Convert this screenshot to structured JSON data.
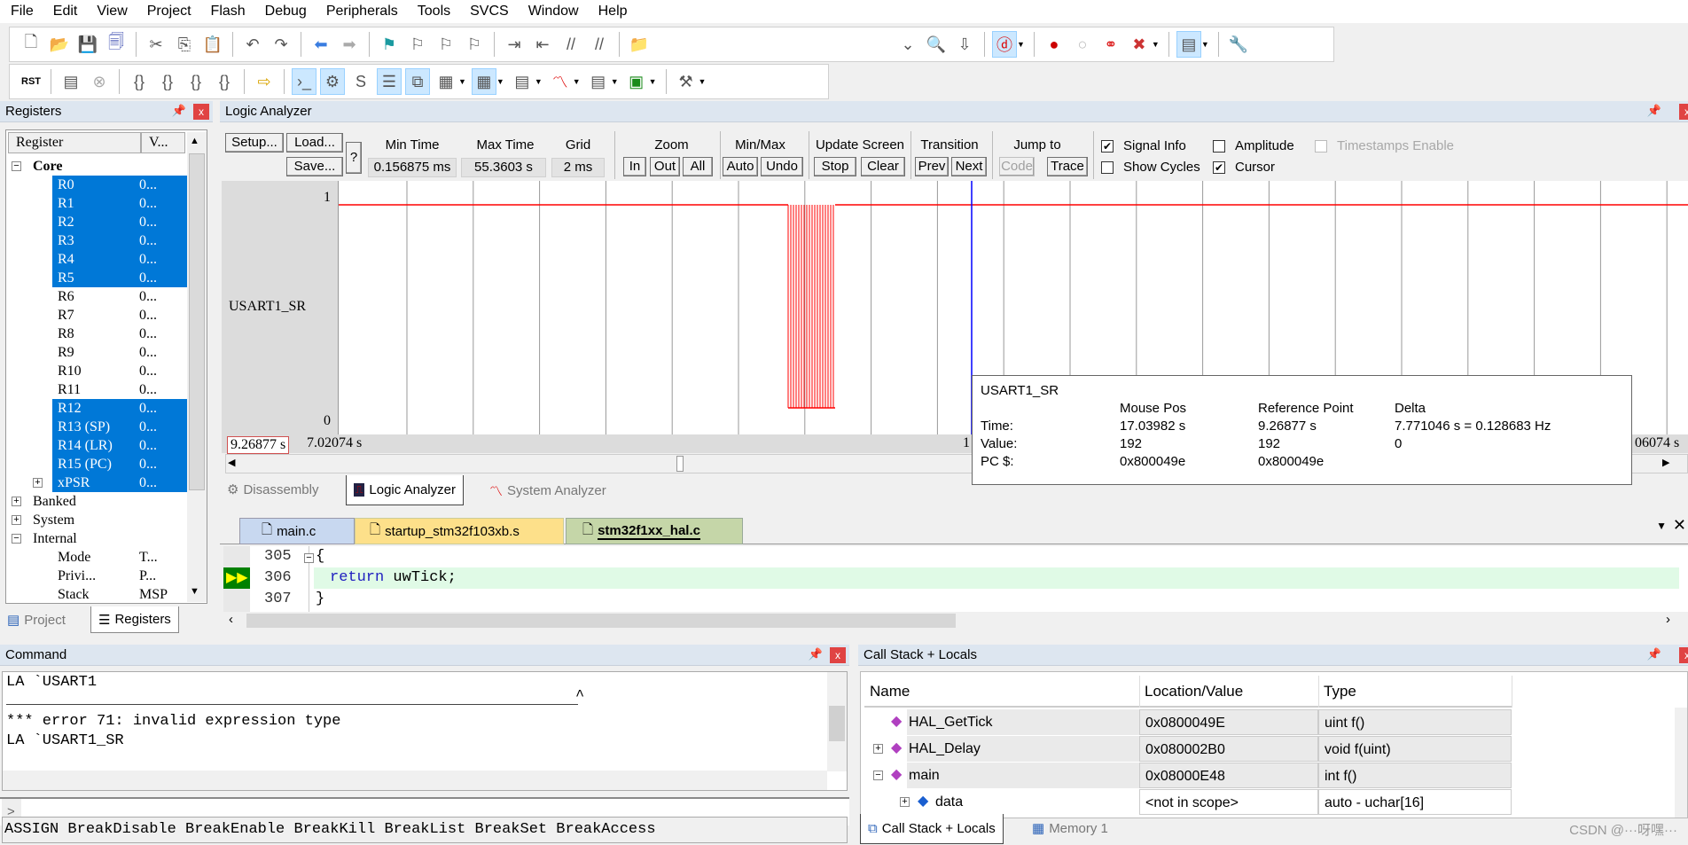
{
  "menu": [
    "File",
    "Edit",
    "View",
    "Project",
    "Flash",
    "Debug",
    "Peripherals",
    "Tools",
    "SVCS",
    "Window",
    "Help"
  ],
  "toolbar1": {
    "left": [
      "new-file",
      "open-file",
      "save",
      "save-all",
      "|",
      "cut",
      "copy",
      "paste",
      "|",
      "undo",
      "redo",
      "|",
      "nav-back",
      "nav-forward",
      "|",
      "bookmark-set",
      "bookmark-prev",
      "bookmark-next",
      "bookmark-clear",
      "|",
      "indent",
      "unindent",
      "comment",
      "uncomment",
      "|",
      "find-in-files"
    ],
    "right": [
      "combo-dropdown",
      "find",
      "incremental-find",
      "|",
      "debug-session",
      "|",
      "breakpoint-insert",
      "breakpoint-disable",
      "breakpoint-disable-all",
      "breakpoint-kill-all",
      "|",
      "window-layout",
      "|",
      "configure"
    ]
  },
  "toolbar2": [
    "reset",
    "|",
    "run",
    "stop",
    "|",
    "step-into",
    "step-over",
    "step-out",
    "run-to-cursor",
    "|",
    "show-next-statement",
    "|",
    "command-window",
    "disassembly-window",
    "symbols-window",
    "registers-window",
    "call-stack-window",
    "watch-window",
    "memory-window",
    "serial-window",
    "analysis-window",
    "trace-window",
    "system-viewer",
    "|",
    "toolbox"
  ],
  "registers": {
    "title": "Registers",
    "col_register": "Register",
    "col_value": "V...",
    "groups": [
      {
        "label": "Core",
        "expanded": true
      },
      {
        "label": "Banked",
        "expanded": false
      },
      {
        "label": "System",
        "expanded": false
      },
      {
        "label": "Internal",
        "expanded": true
      }
    ],
    "core": [
      {
        "name": "R0",
        "value": "0...",
        "selected": true
      },
      {
        "name": "R1",
        "value": "0...",
        "selected": true
      },
      {
        "name": "R2",
        "value": "0...",
        "selected": true
      },
      {
        "name": "R3",
        "value": "0...",
        "selected": true
      },
      {
        "name": "R4",
        "value": "0...",
        "selected": true
      },
      {
        "name": "R5",
        "value": "0...",
        "selected": true
      },
      {
        "name": "R6",
        "value": "0...",
        "selected": false
      },
      {
        "name": "R7",
        "value": "0...",
        "selected": false
      },
      {
        "name": "R8",
        "value": "0...",
        "selected": false
      },
      {
        "name": "R9",
        "value": "0...",
        "selected": false
      },
      {
        "name": "R10",
        "value": "0...",
        "selected": false
      },
      {
        "name": "R11",
        "value": "0...",
        "selected": false
      },
      {
        "name": "R12",
        "value": "0...",
        "selected": true
      },
      {
        "name": "R13 (SP)",
        "value": "0...",
        "selected": true
      },
      {
        "name": "R14 (LR)",
        "value": "0...",
        "selected": true
      },
      {
        "name": "R15 (PC)",
        "value": "0...",
        "selected": true
      },
      {
        "name": "xPSR",
        "value": "0...",
        "selected": true
      }
    ],
    "internal": [
      {
        "name": "Mode",
        "value": "T..."
      },
      {
        "name": "Privi...",
        "value": "P..."
      },
      {
        "name": "Stack",
        "value": "MSP"
      }
    ],
    "tabs": [
      "Project",
      "Registers"
    ]
  },
  "logic_analyzer": {
    "title": "Logic Analyzer",
    "setup": "Setup...",
    "load": "Load...",
    "save": "Save...",
    "help": "?",
    "min_time_label": "Min Time",
    "min_time": "0.156875 ms",
    "max_time_label": "Max Time",
    "max_time": "55.3603 s",
    "grid_label": "Grid",
    "grid": "2 ms",
    "zoom_label": "Zoom",
    "zoom_in": "In",
    "zoom_out": "Out",
    "zoom_all": "All",
    "minmax_label": "Min/Max",
    "auto": "Auto",
    "undo": "Undo",
    "update_label": "Update Screen",
    "stop": "Stop",
    "clear": "Clear",
    "transition_label": "Transition",
    "prev": "Prev",
    "next": "Next",
    "jump_label": "Jump to",
    "code": "Code",
    "trace": "Trace",
    "signal_info": {
      "label": "Signal Info",
      "checked": true
    },
    "show_cycles": {
      "label": "Show Cycles",
      "checked": false
    },
    "amplitude": {
      "label": "Amplitude",
      "checked": false
    },
    "cursor": {
      "label": "Cursor",
      "checked": true
    },
    "timestamps": {
      "label": "Timestamps Enable",
      "checked": false,
      "disabled": true
    },
    "signal_name": "USART1_SR",
    "y_high": "1",
    "y_low": "0",
    "ref_time": "9.26877 s",
    "left_time": "7.02074 s",
    "mid_time": "1",
    "right_time": "06074 s",
    "signal_color": "#ff0000",
    "cursor_color": "#0000ff",
    "tooltip": {
      "signal": "USART1_SR",
      "headers": [
        "Mouse Pos",
        "Reference Point",
        "Delta"
      ],
      "rows": [
        {
          "label": "Time:",
          "mouse": "17.03982 s",
          "ref": "9.26877 s",
          "delta": "7.771046 s = 0.128683 Hz"
        },
        {
          "label": "Value:",
          "mouse": "192",
          "ref": "192",
          "delta": "0"
        },
        {
          "label": "PC $:",
          "mouse": "0x800049e",
          "ref": "0x800049e",
          "delta": ""
        }
      ]
    },
    "view_tabs": [
      "Disassembly",
      "Logic Analyzer",
      "System Analyzer"
    ]
  },
  "editor": {
    "tabs": [
      "main.c",
      "startup_stm32f103xb.s",
      "stm32f1xx_hal.c"
    ],
    "active_tab": 2,
    "lines": [
      {
        "num": "305",
        "text": "{"
      },
      {
        "num": "306",
        "kw": "return",
        "text": " uwTick;",
        "current": true
      },
      {
        "num": "307",
        "text": "}"
      }
    ]
  },
  "command": {
    "title": "Command",
    "output": [
      "LA `USART1",
      "^",
      "*** error 71: invalid expression type",
      "LA `USART1_SR"
    ],
    "prompt": ">",
    "keywords": "ASSIGN BreakDisable BreakEnable BreakKill BreakList BreakSet BreakAccess"
  },
  "callstack": {
    "title": "Call Stack + Locals",
    "columns": [
      "Name",
      "Location/Value",
      "Type"
    ],
    "rows": [
      {
        "name": "HAL_GetTick",
        "value": "0x0800049E",
        "type": "uint f()"
      },
      {
        "name": "HAL_Delay",
        "value": "0x080002B0",
        "type": "void f(uint)"
      },
      {
        "name": "main",
        "value": "0x08000E48",
        "type": "int f()"
      },
      {
        "name": "data",
        "value": "<not in scope>",
        "type": "auto - uchar[16]"
      }
    ],
    "tabs": [
      "Call Stack + Locals",
      "Memory 1"
    ]
  },
  "watermark": "CSDN @···呀嘿···"
}
